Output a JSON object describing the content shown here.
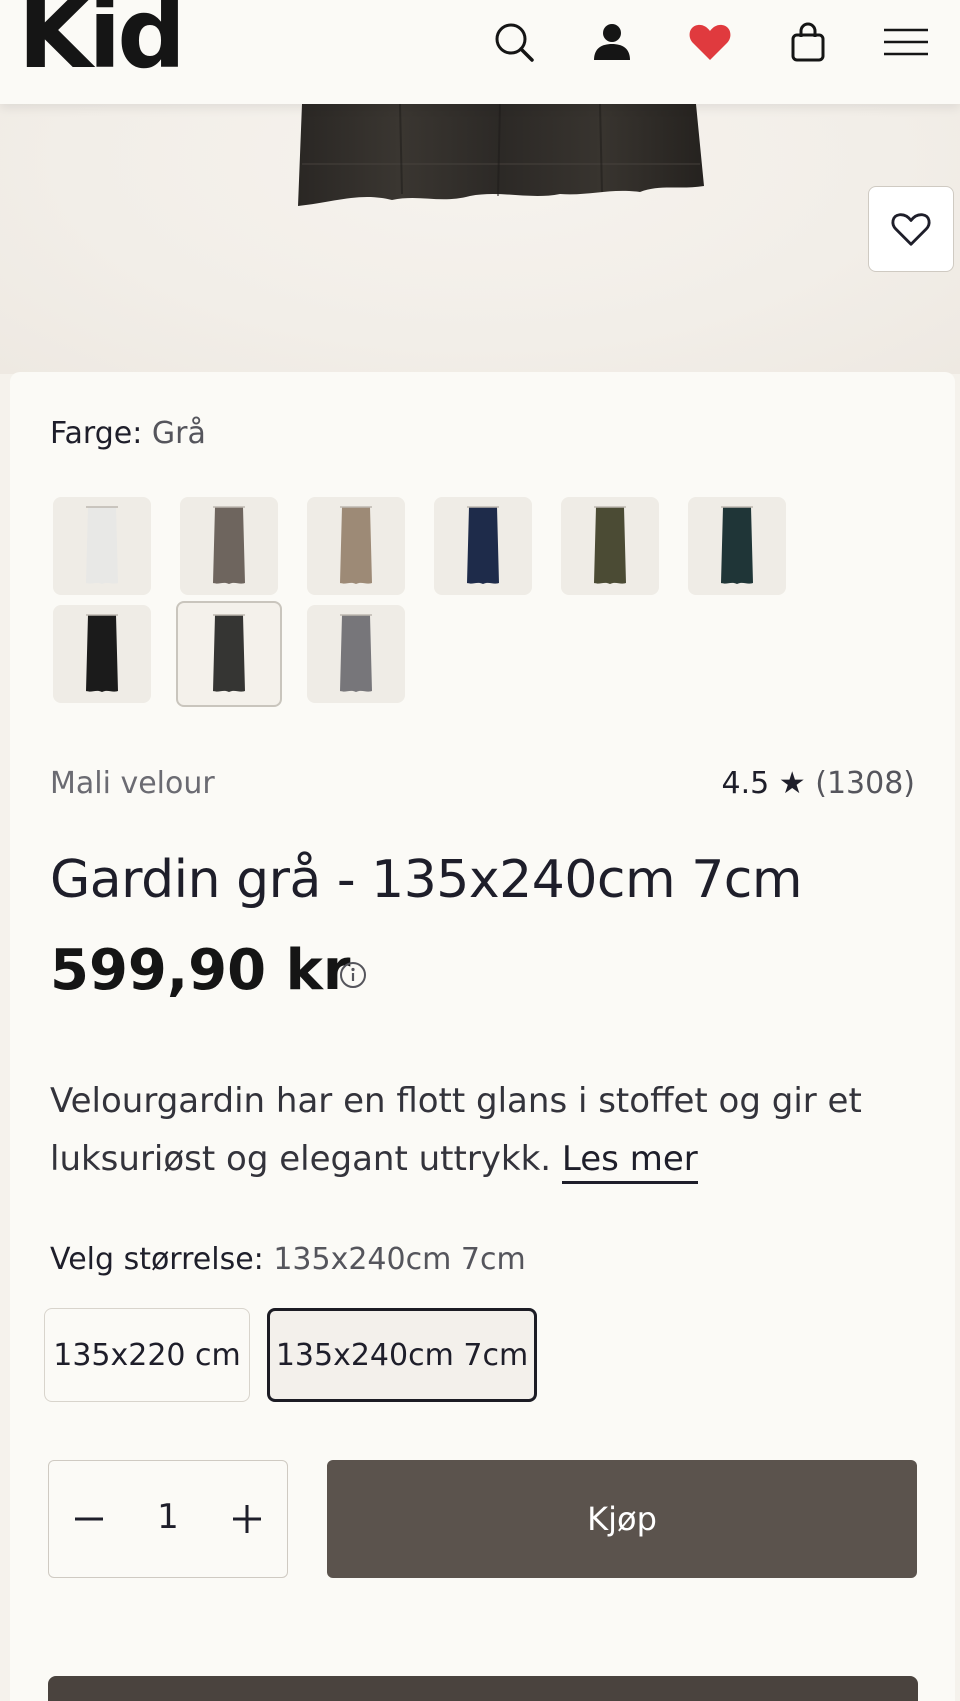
{
  "header": {
    "logo": "Kid",
    "icons": [
      "search-icon",
      "user-icon",
      "heart-icon",
      "bag-icon",
      "menu-icon"
    ],
    "heart_color": "#e03a3e"
  },
  "product": {
    "color_label": "Farge:",
    "color_value": "Grå",
    "swatches": [
      {
        "name": "white",
        "color": "#e8e8e6"
      },
      {
        "name": "taupe",
        "color": "#6e655e"
      },
      {
        "name": "sand",
        "color": "#9d8a76"
      },
      {
        "name": "navy",
        "color": "#1e2b4a"
      },
      {
        "name": "olive",
        "color": "#4b4b34"
      },
      {
        "name": "dark-green",
        "color": "#1f3537"
      },
      {
        "name": "black",
        "color": "#1b1b1b"
      },
      {
        "name": "grey",
        "color": "#353533"
      },
      {
        "name": "light-grey",
        "color": "#77767a"
      }
    ],
    "selected_swatch": 7,
    "brand": "Mali velour",
    "rating": "4.5",
    "rating_count": "(1308)",
    "title": "Gardin grå - 135x240cm 7cm",
    "price": "599,90 kr",
    "description": "Velourgardin har en flott glans i stoffet og gir et luksuriøst og elegant uttrykk.",
    "read_more": "Les mer",
    "size_label": "Velg størrelse:",
    "size_value": "135x240cm 7cm",
    "sizes": [
      "135x220 cm",
      "135x240cm 7cm"
    ],
    "selected_size": 1,
    "quantity": "1",
    "buy_label": "Kjøp"
  }
}
